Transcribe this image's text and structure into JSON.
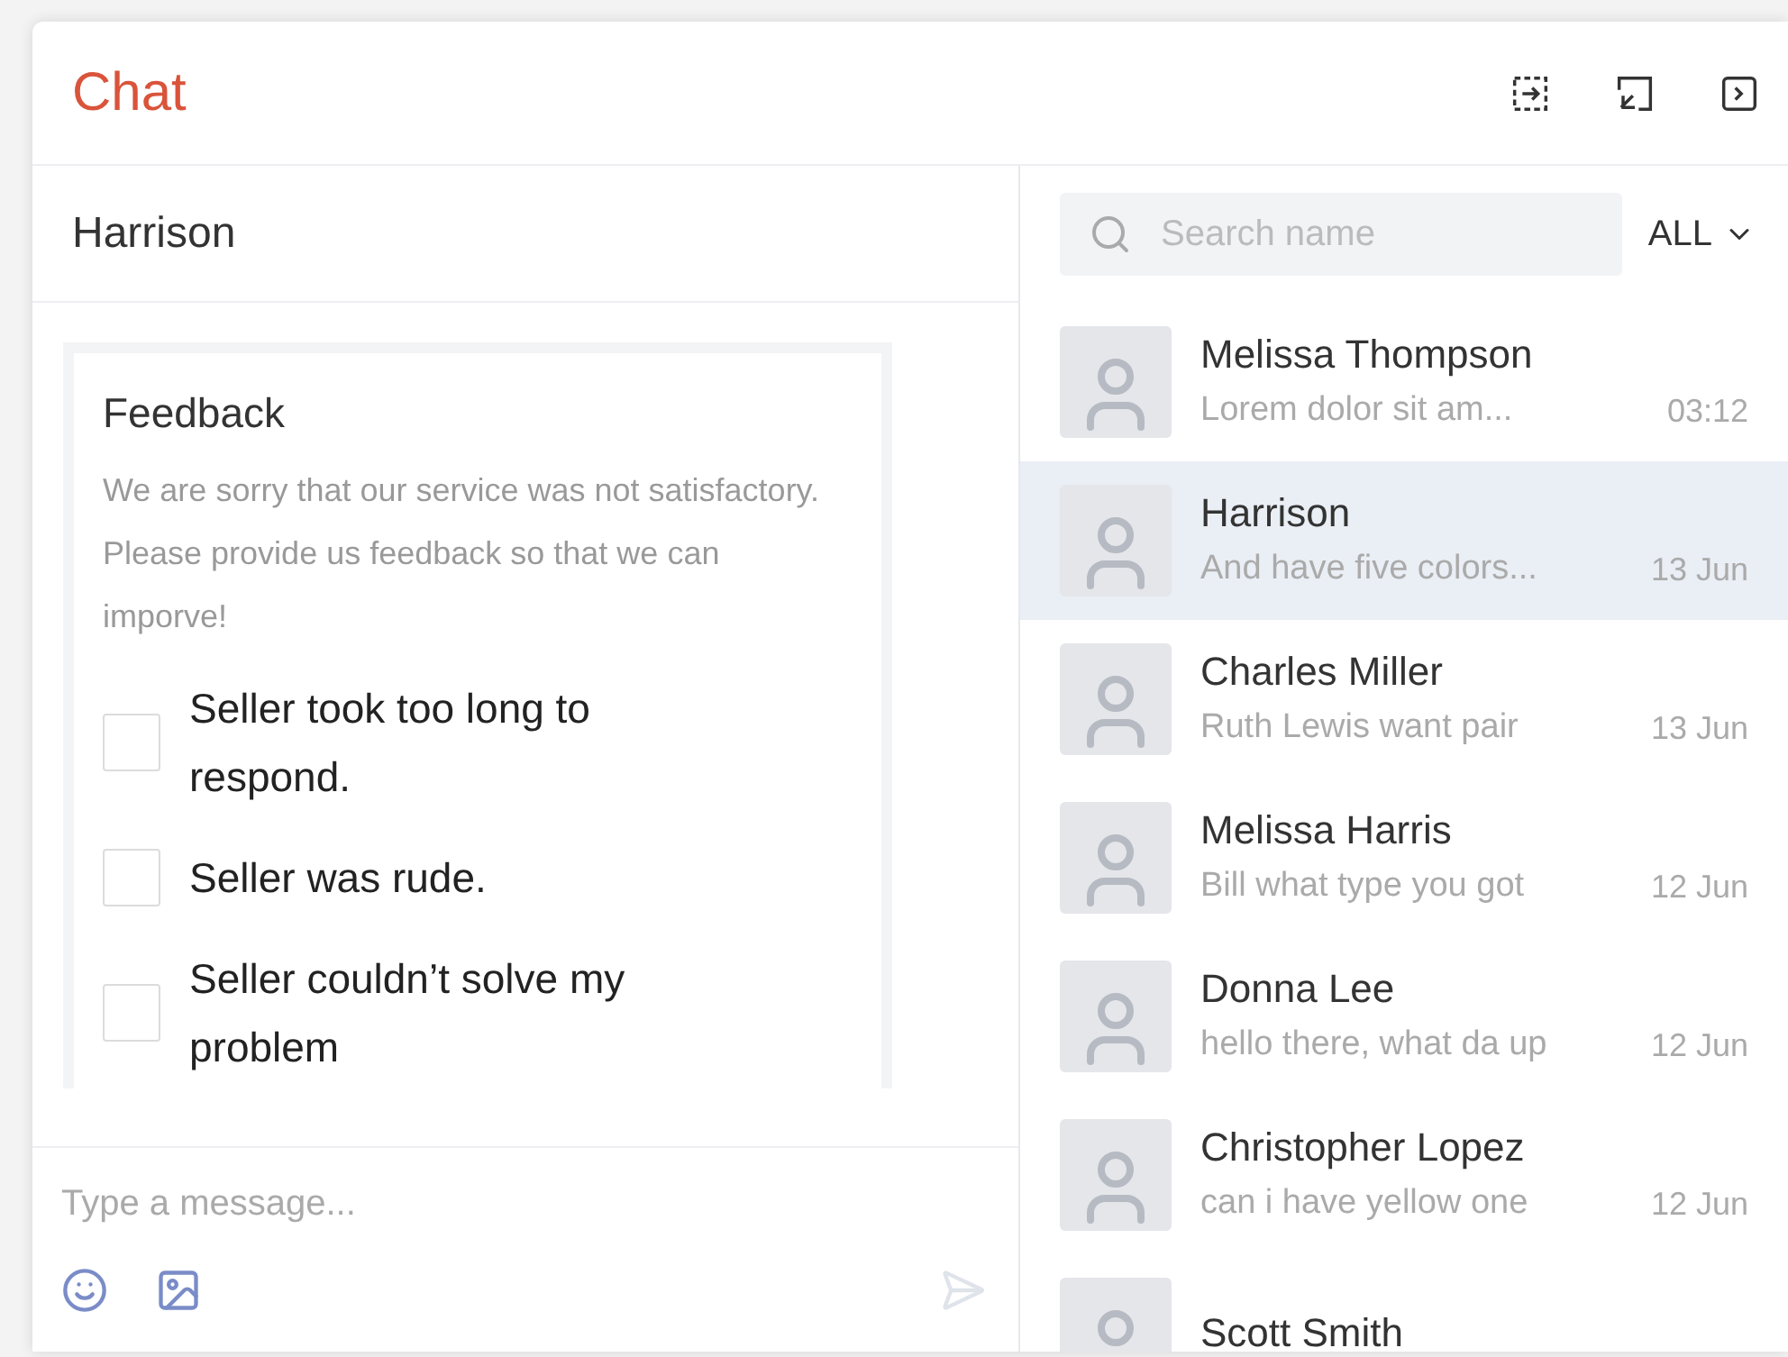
{
  "header": {
    "title": "Chat"
  },
  "conversation": {
    "title": "Harrison",
    "feedback": {
      "title": "Feedback",
      "description": "We are sorry that our service was not satisfactory. Please provide us feedback so that we can imporve!",
      "options": [
        {
          "label": "Seller took too long to respond.",
          "checked": false
        },
        {
          "label": "Seller was rude.",
          "checked": false
        },
        {
          "label": "Seller couldn’t solve my problem",
          "checked": false
        }
      ]
    },
    "composer": {
      "placeholder": "Type a message..."
    }
  },
  "search": {
    "placeholder": "Search name"
  },
  "filter": {
    "label": "ALL"
  },
  "contacts": [
    {
      "name": "Melissa Thompson",
      "preview": "Lorem dolor sit am...",
      "time": "03:12",
      "selected": false
    },
    {
      "name": "Harrison",
      "preview": "And have five colors...",
      "time": "13 Jun",
      "selected": true
    },
    {
      "name": "Charles Miller",
      "preview": "Ruth Lewis want pair",
      "time": "13 Jun",
      "selected": false
    },
    {
      "name": "Melissa Harris",
      "preview": "Bill what type you got",
      "time": "12 Jun",
      "selected": false
    },
    {
      "name": "Donna Lee",
      "preview": "hello there, what da up",
      "time": "12 Jun",
      "selected": false
    },
    {
      "name": "Christopher Lopez",
      "preview": "can i have yellow one",
      "time": "12 Jun",
      "selected": false
    },
    {
      "name": "Scott Smith",
      "selected": false
    }
  ]
}
